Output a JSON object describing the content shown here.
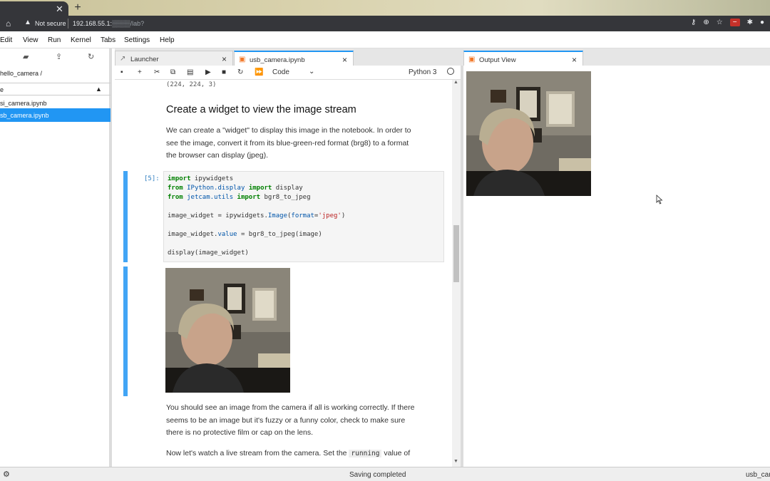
{
  "browser": {
    "new_tab_label": "+",
    "close_glyph": "✕",
    "security_label": "Not secure",
    "url_host": "192.168.55.1:",
    "url_path": "/lab?",
    "icons": [
      "home-icon",
      "warning-icon",
      "key-icon",
      "zoom-icon",
      "star-icon",
      "extension-icon",
      "profile-icon"
    ]
  },
  "menubar": {
    "items": [
      "Edit",
      "View",
      "Run",
      "Kernel",
      "Tabs",
      "Settings",
      "Help"
    ]
  },
  "filebrowser": {
    "breadcrumb": "hello_camera  /",
    "header_label": "e",
    "files": [
      {
        "name": "si_camera.ipynb",
        "selected": false
      },
      {
        "name": "sb_camera.ipynb",
        "selected": true
      }
    ]
  },
  "tabs": [
    {
      "label": "Launcher",
      "active": false
    },
    {
      "label": "usb_camera.ipynb",
      "active": true
    },
    {
      "label": "Output View",
      "active": false
    }
  ],
  "notebook_toolbar": {
    "cell_type": "Code",
    "kernel_name": "Python 3"
  },
  "notebook": {
    "prev_output": "(224, 224, 3)",
    "heading": "Create a widget to view the image stream",
    "intro_lines": [
      "We can create a \"widget\" to display this image in the notebook. In order to",
      "see the image, convert it from its blue-green-red format (brg8) to a format",
      "the browser can display (jpeg)."
    ],
    "prompt": "[5]:",
    "code": {
      "l1_kw": "import",
      "l1_rest": " ipywidgets",
      "l2_kw": "from",
      "l2_mod": " IPython.display ",
      "l2_kw2": "import",
      "l2_rest": " display",
      "l3_kw": "from",
      "l3_mod": " jetcam.utils ",
      "l3_kw2": "import",
      "l3_rest": " bgr8_to_jpeg",
      "l4_a": "image_widget = ipywidgets.",
      "l4_b": "Image",
      "l4_c": "(",
      "l4_d": "format",
      "l4_e": "=",
      "l4_f": "'jpeg'",
      "l4_g": ")",
      "l5_a": "image_widget.",
      "l5_b": "value",
      "l5_c": " = bgr8_to_jpeg(image)",
      "l6": "display(image_widget)"
    },
    "after_lines": [
      "You should see an image from the camera if all is working correctly. If there",
      "seems to be an image but it's fuzzy or a funny color, check to make sure",
      "there is no protective film or cap on the lens."
    ],
    "live_a": "Now let's watch a live stream from the camera. Set the ",
    "live_code": "running",
    "live_b": " value of"
  },
  "statusbar": {
    "message": "Saving completed",
    "notebook_name": "usb_car"
  },
  "colors": {
    "accent_blue": "#2196f3",
    "cell_bar": "#42a5f5",
    "chrome_dark": "#35363a"
  }
}
